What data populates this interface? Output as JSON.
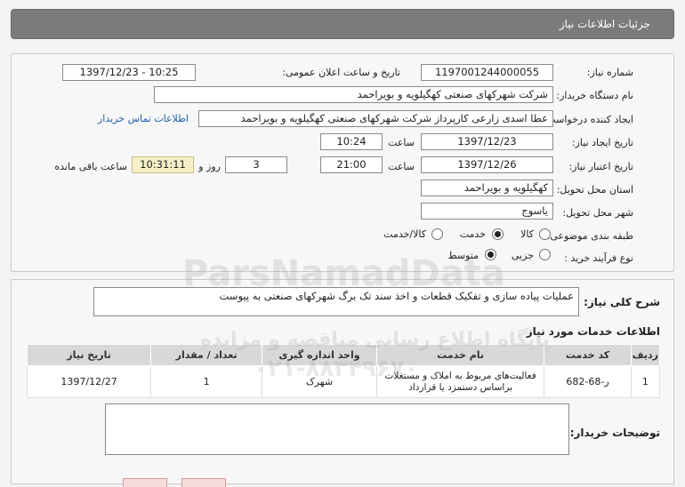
{
  "header": {
    "title": "جزئیات اطلاعات نیاز"
  },
  "form": {
    "need_number_label": "شماره نیاز:",
    "need_number": "1197001244000055",
    "announce_label": "تاریخ و ساعت اعلان عمومی:",
    "announce_value": "1397/12/23 - 10:25",
    "buyer_org_label": "نام دستگاه خریدار:",
    "buyer_org": "شرکت شهرکهای صنعتی کهگیلویه و بویراحمد",
    "creator_label": "ایجاد کننده درخواست:",
    "creator": "عطا اسدی زارعی کارپرداز شرکت شهرکهای صنعتی کهگیلویه و بویراحمد",
    "contact_link": "اطلاعات تماس خریدار",
    "created_date_label": "تاریخ ایجاد نیاز:",
    "created_date": "1397/12/23",
    "time_label": "ساعت",
    "created_time": "10:24",
    "validity_label": "تاریخ اعتبار نیاز:",
    "validity_date": "1397/12/26",
    "validity_time": "21:00",
    "days_value": "3",
    "days_label": "روز و",
    "remaining_time": "10:31:11",
    "remaining_label": "ساعت باقی مانده",
    "province_label": "استان محل تحویل:",
    "province": "کهگیلویه و بویراحمد",
    "city_label": "شهر محل تحویل:",
    "city": "یاسوج",
    "category_label": "طبقه بندی موضوعی:",
    "category_options": [
      "کالا",
      "خدمت",
      "کالا/خدمت"
    ],
    "category_selected": "خدمت",
    "process_label": "نوع فرآیند خرید :",
    "process_options": [
      "جزیی",
      "متوسط"
    ],
    "process_selected": "متوسط"
  },
  "summary": {
    "label": "شرح کلی نیاز:",
    "text": "عملیات پیاده سازی و تفکیک قطعات و اخذ سند تک برگ شهرکهای صنعتی به پیوست"
  },
  "services": {
    "title": "اطلاعات خدمات مورد نیاز",
    "columns": [
      "ردیف",
      "کد خدمت",
      "نام خدمت",
      "واحد اندازه گیری",
      "تعداد / مقدار",
      "تاریخ نیاز"
    ],
    "rows": [
      {
        "row": "1",
        "code": "ر-68-682",
        "name": "فعالیت‌های مربوط به املاک و مستغلات براساس دستمزد یا قرارداد",
        "unit": "شهرک",
        "qty": "1",
        "date": "1397/12/27"
      }
    ]
  },
  "buyer_notes": {
    "label": "توضیحات خریدار:",
    "text": ""
  },
  "watermark": {
    "brand": "ParsNamadData",
    "line1": "پایگاه اطلاع رسانی مناقصه و مزایده",
    "phone": "۰۲۱-۸۸۳۴۹۶۷۰"
  },
  "colors": {
    "header_bg": "#7b7b7b",
    "link": "#1f5fa8",
    "highlight": "#f7efc7"
  }
}
